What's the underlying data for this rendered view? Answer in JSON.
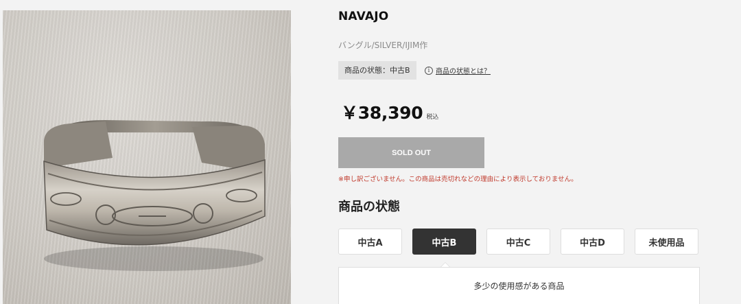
{
  "product": {
    "brand": "NAVAJO",
    "subtitle": "バングル/SILVER/IJIM作",
    "image_alt_icon": "bangle-photo",
    "condition_badge": "商品の状態：中古B",
    "condition_help_link": "商品の状態とは？",
    "price": "￥38,390",
    "tax_label": "税込",
    "sold_out_label": "SOLD OUT",
    "sold_out_notice": "※申し訳ございません。この商品は売切れなどの理由により表示しておりません。"
  },
  "condition_section": {
    "title": "商品の状態",
    "tabs": [
      {
        "label": "中古A",
        "active": false
      },
      {
        "label": "中古B",
        "active": true
      },
      {
        "label": "中古C",
        "active": false
      },
      {
        "label": "中古D",
        "active": false
      },
      {
        "label": "未使用品",
        "active": false
      }
    ],
    "description": "多少の使用感がある商品"
  },
  "colors": {
    "background": "#f3f3f3",
    "active_tab": "#333333",
    "sold_out_button": "#a9a9a9",
    "notice_text": "#c0392b"
  }
}
